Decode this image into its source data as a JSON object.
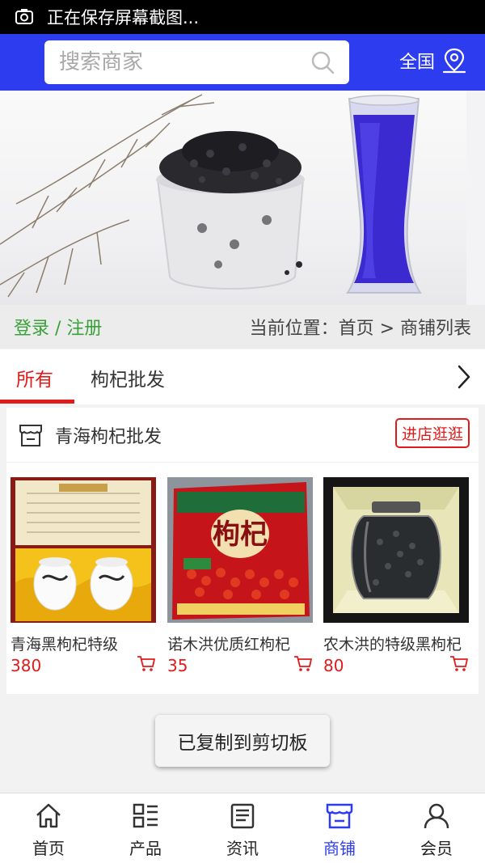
{
  "status_bar": {
    "text": "正在保存屏幕截图..."
  },
  "header": {
    "search_placeholder": "搜索商家",
    "region_label": "全国"
  },
  "breadcrumb": {
    "login_label": "登录 / 注册",
    "location": "当前位置：首页 > 商铺列表"
  },
  "tabs": [
    {
      "label": "所有",
      "active": true
    },
    {
      "label": "枸杞批发",
      "active": false
    }
  ],
  "shop": {
    "name": "青海枸杞批发",
    "visit_label": "进店逛逛",
    "products": [
      {
        "name": "青海黑枸杞特级",
        "price": "380"
      },
      {
        "name": "诺木洪优质红枸杞",
        "price": "35"
      },
      {
        "name": "农木洪的特级黑枸杞",
        "price": "80"
      }
    ]
  },
  "toast": {
    "text": "已复制到剪切板"
  },
  "bottom_nav": [
    {
      "label": "首页",
      "icon": "home-icon"
    },
    {
      "label": "产品",
      "icon": "products-icon"
    },
    {
      "label": "资讯",
      "icon": "news-icon"
    },
    {
      "label": "商铺",
      "icon": "store-icon",
      "active": true
    },
    {
      "label": "会员",
      "icon": "user-icon"
    }
  ],
  "colors": {
    "brand_blue": "#2e3cf0",
    "accent_red": "#e01b1b",
    "login_green": "#3aa13a"
  }
}
